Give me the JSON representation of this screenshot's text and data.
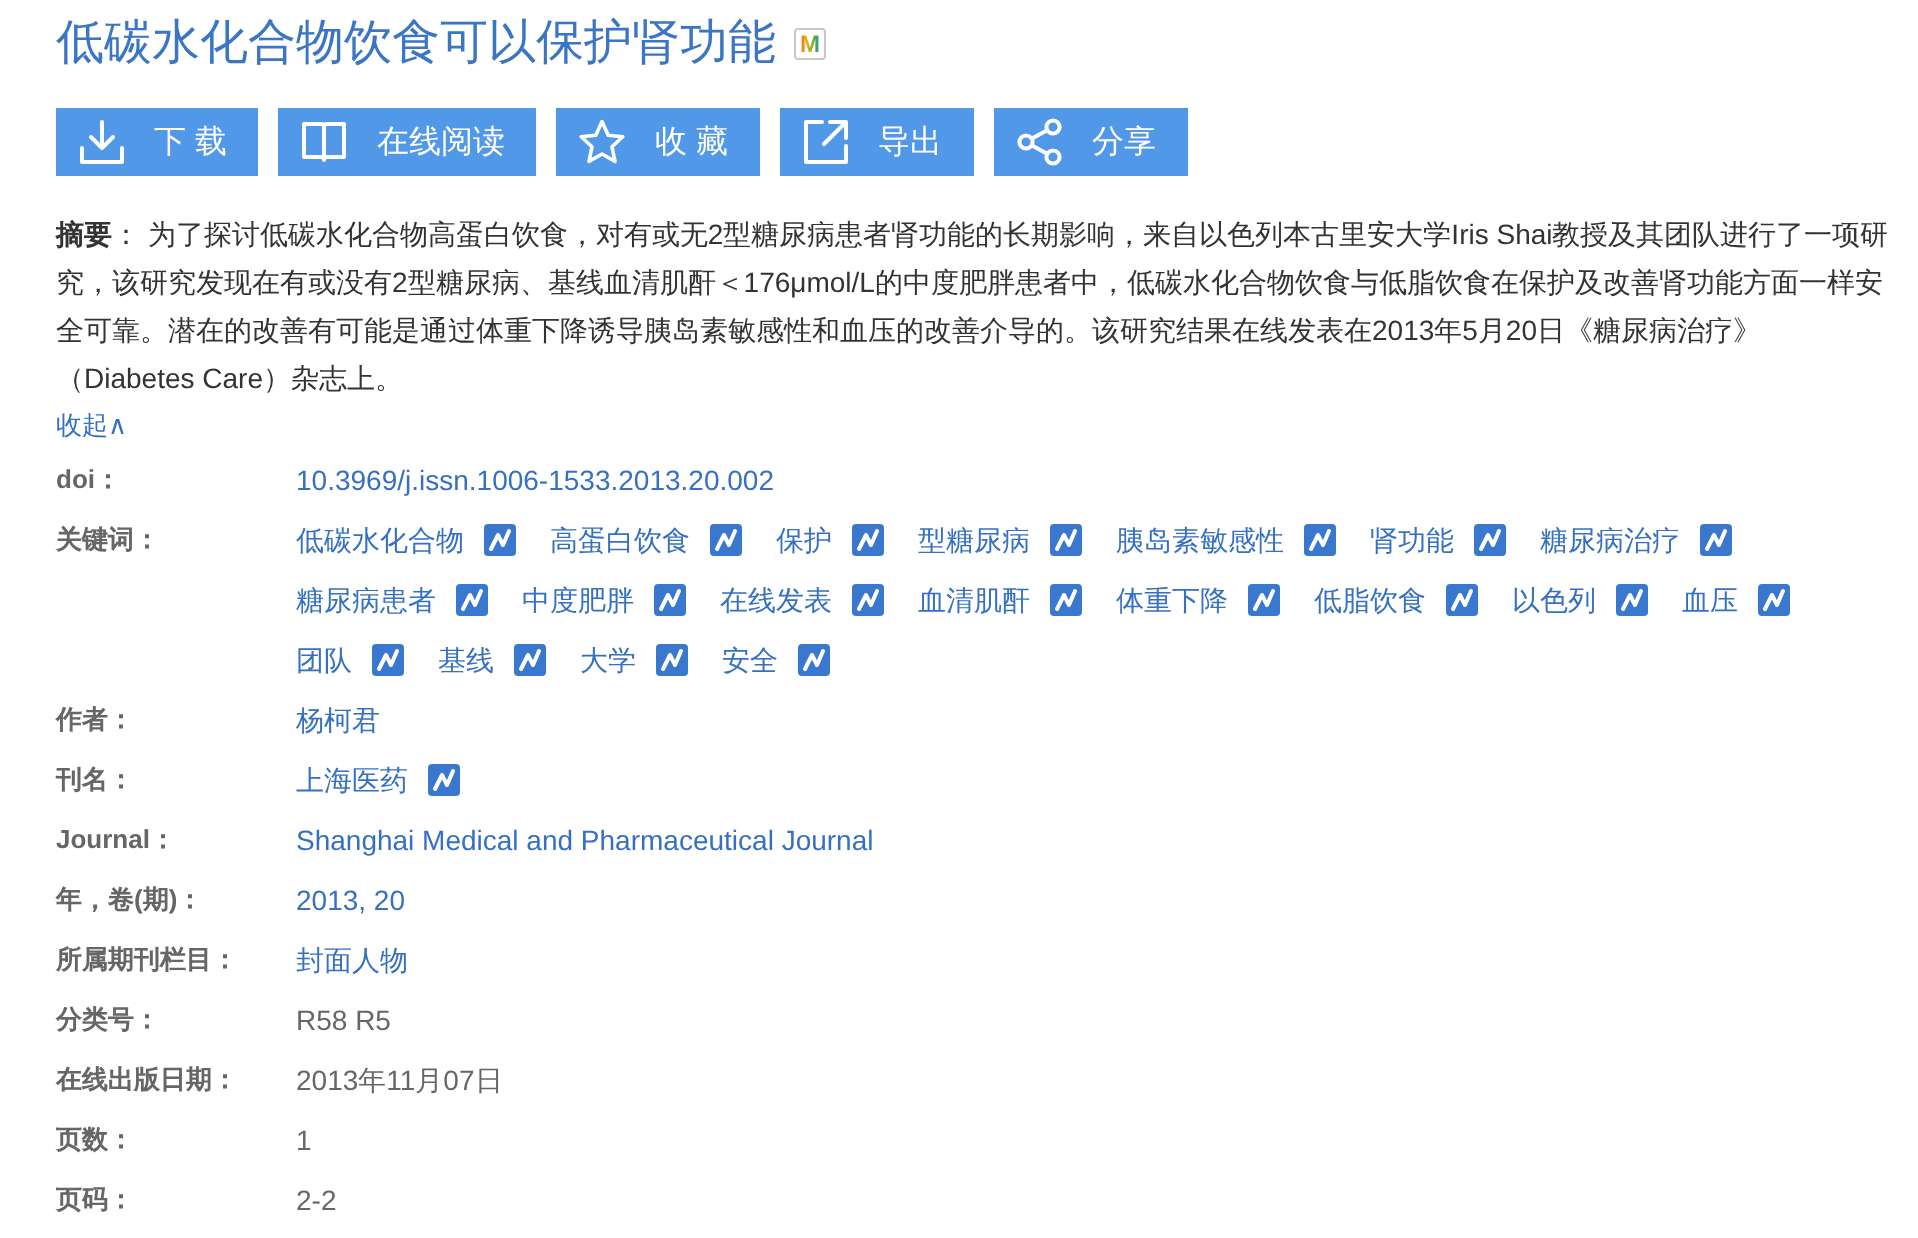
{
  "title": {
    "text": "低碳水化合物饮食可以保护肾功能",
    "badge": "M"
  },
  "actions": [
    {
      "kind": "download",
      "label": "下 载"
    },
    {
      "kind": "read",
      "label": "在线阅读"
    },
    {
      "kind": "favorite",
      "label": "收 藏"
    },
    {
      "kind": "export",
      "label": "导出"
    },
    {
      "kind": "share",
      "label": "分享"
    }
  ],
  "abstract": {
    "text": "**摘要**： 为了探讨低碳水化合物高蛋白饮食，对有或无2型糖尿病患者肾功能的长期影响，来自以色列本古里安大学Iris Shai教授及其团队进行了一项研究，该研究发现在有或没有2型糖尿病、基线血清肌酐＜176μmol/L的中度肥胖患者中，低碳水化合物饮食与低脂饮食在保护及改善肾功能方面一样安全可靠。潜在的改善有可能是通过体重下降诱导胰岛素敏感性和血压的改善介导的。该研究结果在线发表在2013年5月20日《糖尿病治疗》（Diabetes Care）杂志上。",
    "toggle": "收起∧"
  },
  "fields": [
    {
      "label": "doi：",
      "kind": "link",
      "value": "10.3969/j.issn.1006-1533.2013.20.002"
    },
    {
      "label": "关键词：",
      "kind": "tags",
      "tags": [
        "低碳水化合物",
        "高蛋白饮食",
        "保护",
        "型糖尿病",
        "胰岛素敏感性",
        "肾功能",
        "糖尿病治疗",
        "糖尿病患者",
        "中度肥胖",
        "在线发表",
        "血清肌酐",
        "体重下降",
        "低脂饮食",
        "以色列",
        "血压",
        "团队",
        "基线",
        "大学",
        "安全"
      ]
    },
    {
      "label": "作者：",
      "kind": "link",
      "value": "杨柯君"
    },
    {
      "label": "刊名：",
      "kind": "tags",
      "tags": [
        "上海医药"
      ]
    },
    {
      "label": "Journal：",
      "kind": "link",
      "value": "Shanghai Medical and Pharmaceutical Journal"
    },
    {
      "label": "年，卷(期)：",
      "kind": "link",
      "value": "2013, 20"
    },
    {
      "label": "所属期刊栏目：",
      "kind": "link",
      "value": "封面人物"
    },
    {
      "label": "分类号：",
      "kind": "text",
      "value": "R58 R5"
    },
    {
      "label": "在线出版日期：",
      "kind": "text",
      "value": "2013年11月07日"
    },
    {
      "label": "页数：",
      "kind": "text",
      "value": "1"
    },
    {
      "label": "页码：",
      "kind": "text",
      "value": "2-2"
    }
  ]
}
